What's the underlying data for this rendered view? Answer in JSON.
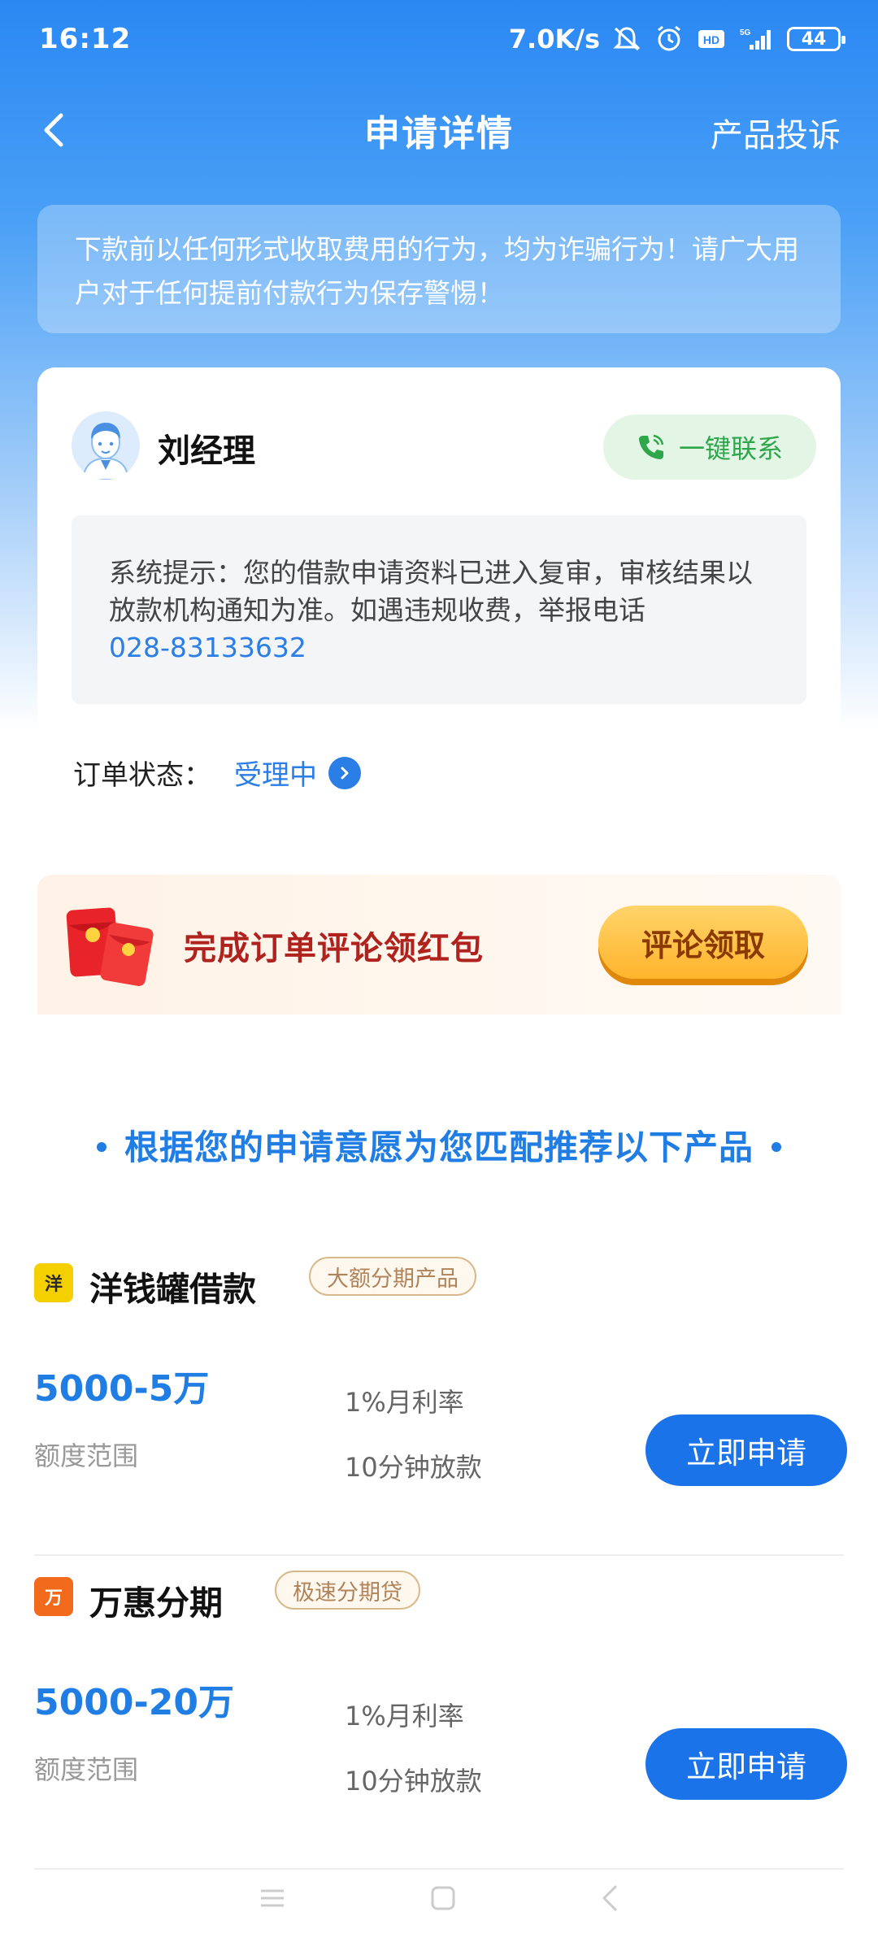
{
  "status_bar": {
    "time": "16:12",
    "speed": "7.0K/s",
    "network": "5G",
    "battery": "44"
  },
  "header": {
    "title": "申请详情",
    "complaint": "产品投诉"
  },
  "notice": {
    "text": "下款前以任何形式收取费用的行为，均为诈骗行为！请广大用户对于任何提前付款行为保存警惕！"
  },
  "manager": {
    "name": "刘经理",
    "contact_label": "一键联系",
    "tip_text": "系统提示：您的借款申请资料已进入复审，审核结果以放款机构通知为准。如遇违规收费，举报电话",
    "phone": "028-83133632",
    "status_label": "订单状态：",
    "status_value": "受理中"
  },
  "banner": {
    "text": "完成订单评论领红包",
    "button": "评论领取"
  },
  "recommend": {
    "title": "根据您的申请意愿为您匹配推荐以下产品",
    "products": [
      {
        "name": "洋钱罐借款",
        "tag": "大额分期产品",
        "amount": "5000-5万",
        "amount_label": "额度范围",
        "rate": "1%月利率",
        "speed": "10分钟放款",
        "button": "立即申请",
        "logo_text": "洋",
        "logo_color": "#f5d000"
      },
      {
        "name": "万惠分期",
        "tag": "极速分期贷",
        "amount": "5000-20万",
        "amount_label": "额度范围",
        "rate": "1%月利率",
        "speed": "10分钟放款",
        "button": "立即申请",
        "logo_text": "万",
        "logo_color": "#f26a1b"
      }
    ]
  },
  "colors": {
    "primary": "#1f7de4",
    "header_bg": "#2a88f3",
    "contact_green": "#2ea64a",
    "banner_red": "#b0221e",
    "claim_orange": "#ffb42c"
  }
}
